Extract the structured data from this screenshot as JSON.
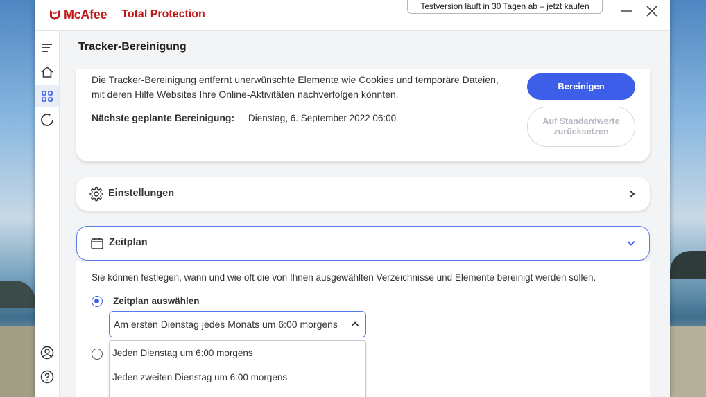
{
  "app": {
    "brand": "McAfee",
    "product": "Total Protection",
    "trial_button": "Testversion läuft in 30 Tagen ab – jetzt kaufen",
    "colors": {
      "brand_red": "#c01818",
      "accent_blue": "#3d5ee8"
    }
  },
  "sidebar": {
    "icons": [
      "menu-icon",
      "home-icon",
      "apps-grid-icon",
      "progress-circle-icon",
      "account-icon",
      "help-icon"
    ]
  },
  "page": {
    "title": "Tracker-Bereinigung"
  },
  "overview": {
    "description": "Die Tracker-Bereinigung entfernt unerwünschte Elemente wie Cookies und temporäre Dateien, mit deren Hilfe Websites Ihre Online-Aktivitäten nachverfolgen könnten.",
    "next_label": "Nächste geplante Bereinigung:",
    "next_value": "Dienstag, 6. September 2022 06:00",
    "clean_button": "Bereinigen",
    "reset_button": "Auf Standardwerte zurücksetzen"
  },
  "settings": {
    "title": "Einstellungen"
  },
  "schedule": {
    "title": "Zeitplan",
    "description": "Sie können festlegen, wann und wie oft die von Ihnen ausgewählten Verzeichnisse und Elemente bereinigt werden sollen.",
    "radio_label": "Zeitplan auswählen",
    "selected_option": "Am ersten Dienstag jedes Monats um 6:00 morgens",
    "options": [
      "Jeden Dienstag um 6:00 morgens",
      "Jeden zweiten Dienstag um 6:00 morgens"
    ]
  }
}
